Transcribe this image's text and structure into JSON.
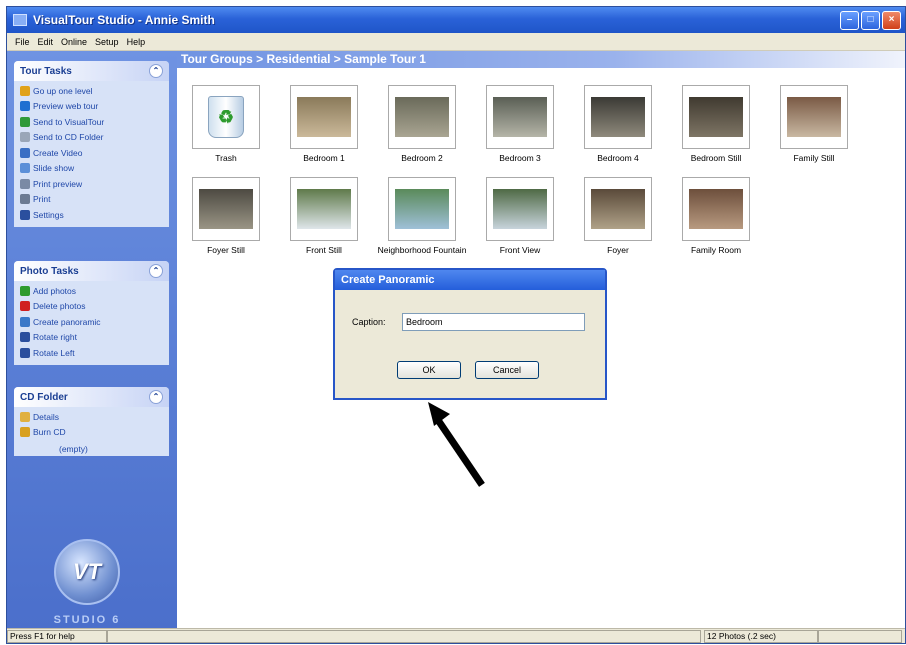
{
  "window": {
    "title": "VisualTour Studio - Annie Smith"
  },
  "menu": [
    "File",
    "Edit",
    "Online",
    "Setup",
    "Help"
  ],
  "tour_tasks": {
    "header": "Tour Tasks",
    "items": [
      {
        "label": "Go up one level",
        "icon": "folder-up-icon",
        "color": "#e0a21a"
      },
      {
        "label": "Preview web tour",
        "icon": "magnifier-icon",
        "color": "#1f6fd1"
      },
      {
        "label": "Send to VisualTour",
        "icon": "globe-icon",
        "color": "#2f9a3a"
      },
      {
        "label": "Send to CD Folder",
        "icon": "cd-icon",
        "color": "#9aa6b8"
      },
      {
        "label": "Create Video",
        "icon": "video-icon",
        "color": "#3b6fc4"
      },
      {
        "label": "Slide show",
        "icon": "slideshow-icon",
        "color": "#5b8fd8"
      },
      {
        "label": "Print preview",
        "icon": "print-preview-icon",
        "color": "#7a8aa5"
      },
      {
        "label": "Print",
        "icon": "printer-icon",
        "color": "#6c7b93"
      },
      {
        "label": "Settings",
        "icon": "settings-icon",
        "color": "#2b4f9e"
      }
    ]
  },
  "photo_tasks": {
    "header": "Photo Tasks",
    "items": [
      {
        "label": "Add photos",
        "icon": "add-icon",
        "color": "#2e9b2e"
      },
      {
        "label": "Delete photos",
        "icon": "delete-icon",
        "color": "#d02020"
      },
      {
        "label": "Create panoramic",
        "icon": "panorama-icon",
        "color": "#3a78c8"
      },
      {
        "label": "Rotate right",
        "icon": "rotate-right-icon",
        "color": "#2b4f9e"
      },
      {
        "label": "Rotate Left",
        "icon": "rotate-left-icon",
        "color": "#2b4f9e"
      }
    ]
  },
  "cd_folder": {
    "header": "CD Folder",
    "items": [
      {
        "label": "Details",
        "icon": "details-icon",
        "color": "#e0b040"
      },
      {
        "label": "Burn CD",
        "icon": "burn-cd-icon",
        "color": "#d8a020"
      }
    ],
    "empty_note": "(empty)"
  },
  "logo": {
    "mark": "VT",
    "text": "STUDIO 6"
  },
  "breadcrumb": "Tour Groups > Residential > Sample Tour 1",
  "thumbnails": [
    {
      "label": "Trash",
      "kind": "trash"
    },
    {
      "label": "Bedroom 1",
      "kind": "photo",
      "colors": [
        "#8a7a5a",
        "#cbb99a"
      ]
    },
    {
      "label": "Bedroom 2",
      "kind": "photo",
      "colors": [
        "#6a6a5a",
        "#a9a592"
      ]
    },
    {
      "label": "Bedroom 3",
      "kind": "photo",
      "colors": [
        "#5a5f55",
        "#b5b5a8"
      ]
    },
    {
      "label": "Bedroom 4",
      "kind": "photo",
      "colors": [
        "#3b3a35",
        "#8f8a7c"
      ]
    },
    {
      "label": "Bedroom Still",
      "kind": "photo",
      "colors": [
        "#403a30",
        "#7e7565"
      ]
    },
    {
      "label": "Family Still",
      "kind": "photo",
      "colors": [
        "#7a5a45",
        "#c9b8a2"
      ]
    },
    {
      "label": "Foyer Still",
      "kind": "photo",
      "colors": [
        "#4d4a42",
        "#9a9585"
      ]
    },
    {
      "label": "Front Still",
      "kind": "photo",
      "colors": [
        "#5f7a4a",
        "#dfe6ea"
      ]
    },
    {
      "label": "Neighborhood Fountain",
      "kind": "photo",
      "colors": [
        "#5a8a5a",
        "#9fc0d8"
      ]
    },
    {
      "label": "Front View",
      "kind": "photo",
      "colors": [
        "#4f6a45",
        "#c8d4dc"
      ]
    },
    {
      "label": "Foyer",
      "kind": "photo",
      "colors": [
        "#5a4a3a",
        "#b0a288"
      ]
    },
    {
      "label": "Family Room",
      "kind": "photo",
      "colors": [
        "#6d4f3c",
        "#b89a80"
      ]
    }
  ],
  "dialog": {
    "title": "Create Panoramic",
    "caption_label": "Caption:",
    "caption_value": "Bedroom",
    "ok_label": "OK",
    "cancel_label": "Cancel"
  },
  "status": {
    "help": "Press F1 for help",
    "photos": "12 Photos (.2 sec)"
  }
}
